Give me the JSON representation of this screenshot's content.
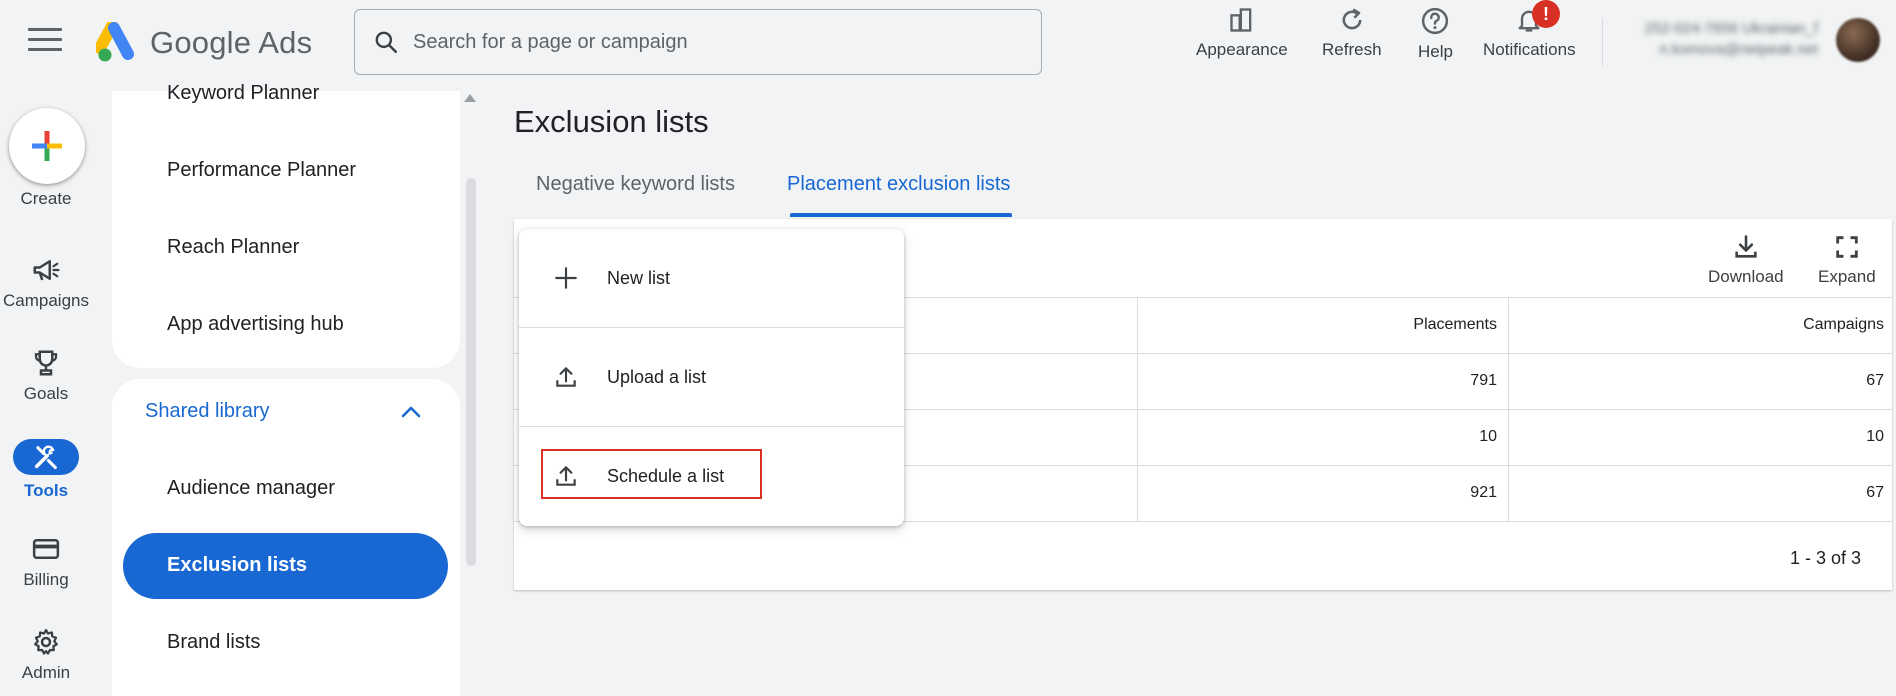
{
  "app": {
    "name": "Google Ads",
    "search_placeholder": "Search for a page or campaign"
  },
  "toolbar": {
    "appearance": "Appearance",
    "refresh": "Refresh",
    "help": "Help",
    "notifications": "Notifications",
    "notification_badge": "!"
  },
  "account": {
    "id": "252-024-7656 Ukrainian_f",
    "email": "n.komova@netpeak.net"
  },
  "rail": {
    "create": "Create",
    "campaigns": "Campaigns",
    "goals": "Goals",
    "tools": "Tools",
    "billing": "Billing",
    "admin": "Admin"
  },
  "sidenav": {
    "keyword_planner": "Keyword Planner",
    "performance_planner": "Performance Planner",
    "reach_planner": "Reach Planner",
    "app_hub": "App advertising hub",
    "shared_library": "Shared library",
    "audience_manager": "Audience manager",
    "exclusion_lists": "Exclusion lists",
    "brand_lists": "Brand lists"
  },
  "page": {
    "title": "Exclusion lists",
    "tabs": [
      "Negative keyword lists",
      "Placement exclusion lists"
    ]
  },
  "table": {
    "actions": {
      "download": "Download",
      "expand": "Expand"
    },
    "columns": [
      "Placements",
      "Campaigns"
    ],
    "rows": [
      {
        "placements": "791",
        "campaigns": "67"
      },
      {
        "placements": "10",
        "campaigns": "10"
      },
      {
        "placements": "921",
        "campaigns": "67"
      }
    ],
    "pager": "1 - 3 of 3"
  },
  "menu": {
    "items": [
      "New list",
      "Upload a list",
      "Schedule a list"
    ]
  },
  "colors": {
    "accent": "#1967d2",
    "highlight": "#d93025",
    "background": "#f1f3f4"
  }
}
